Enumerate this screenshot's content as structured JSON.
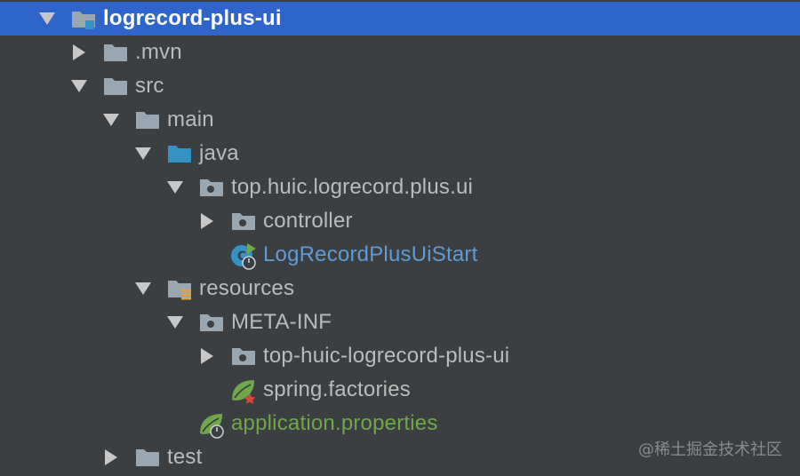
{
  "tree": {
    "root": {
      "label": "logrecord-plus-ui",
      "icon": "module-folder-icon"
    },
    "mvn": {
      "label": ".mvn",
      "icon": "folder-icon"
    },
    "src": {
      "label": "src",
      "icon": "folder-icon"
    },
    "main": {
      "label": "main",
      "icon": "folder-icon"
    },
    "java": {
      "label": "java",
      "icon": "source-root-folder-icon"
    },
    "package": {
      "label": "top.huic.logrecord.plus.ui",
      "icon": "package-icon"
    },
    "controller": {
      "label": "controller",
      "icon": "package-icon"
    },
    "start_class": {
      "label": "LogRecordPlusUiStart",
      "icon": "spring-boot-class-icon"
    },
    "resources": {
      "label": "resources",
      "icon": "resources-root-folder-icon"
    },
    "meta_inf": {
      "label": "META-INF",
      "icon": "package-icon"
    },
    "top_huic": {
      "label": "top-huic-logrecord-plus-ui",
      "icon": "package-icon"
    },
    "spring_factories": {
      "label": "spring.factories",
      "icon": "spring-config-icon"
    },
    "app_props": {
      "label": "application.properties",
      "icon": "spring-boot-config-icon"
    },
    "test": {
      "label": "test",
      "icon": "folder-icon"
    }
  },
  "colors": {
    "background": "#3c3f41",
    "selection": "#2f65ca",
    "text": "#bbbbbb",
    "class_blue": "#5f9bd5",
    "config_green": "#6fa74a"
  },
  "watermark": "@稀土掘金技术社区"
}
